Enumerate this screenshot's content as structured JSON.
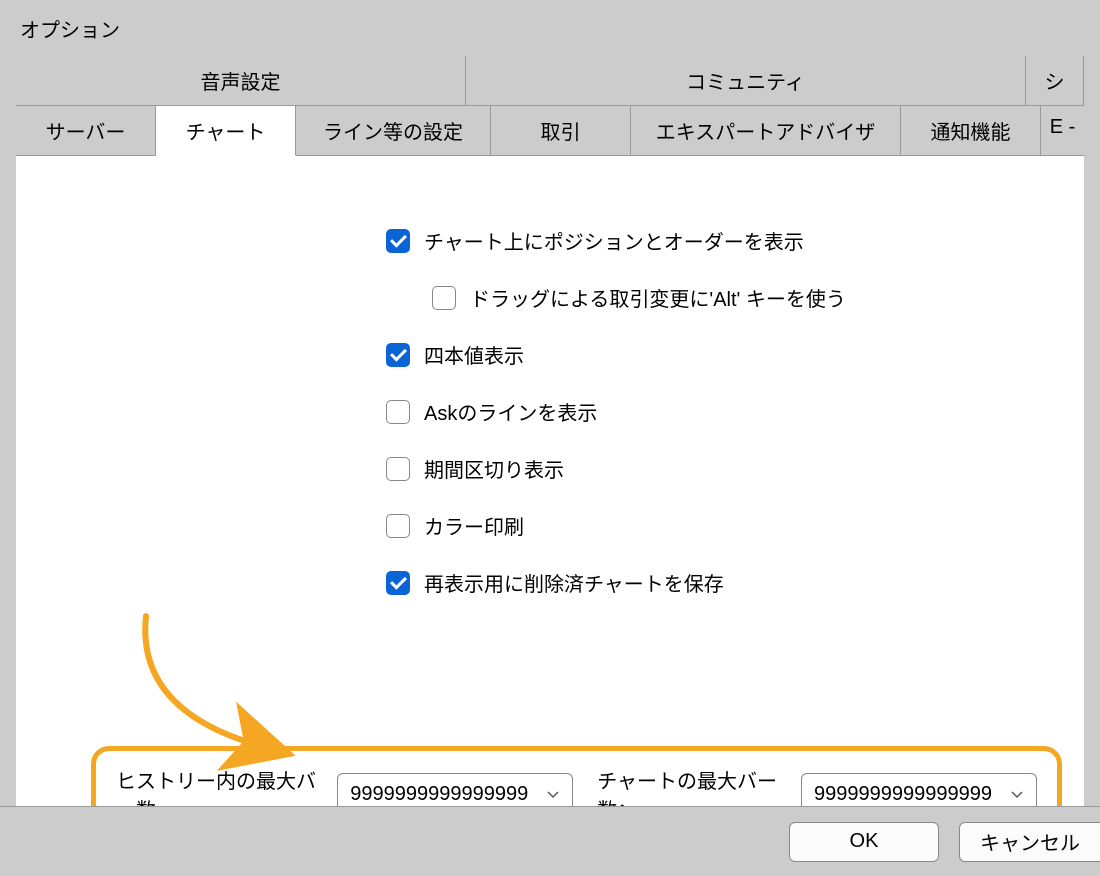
{
  "window": {
    "title": "オプション"
  },
  "tabs_top": {
    "audio": "音声設定",
    "community": "コミュニティ",
    "sig": "シ"
  },
  "tabs_sec": {
    "server": "サーバー",
    "chart": "チャート",
    "lines": "ライン等の設定",
    "trade": "取引",
    "ea": "エキスパートアドバイザ",
    "notify": "通知機能",
    "email": "E -"
  },
  "options": {
    "show_positions": "チャート上にポジションとオーダーを表示",
    "use_alt_drag": "ドラッグによる取引変更に'Alt' キーを使う",
    "ohlc": "四本値表示",
    "ask_line": "Askのラインを表示",
    "period_sep": "期間区切り表示",
    "color_print": "カラー印刷",
    "save_deleted": "再表示用に削除済チャートを保存"
  },
  "bars": {
    "history_label": "ヒストリー内の最大バー数",
    "history_value": "9999999999999999",
    "chart_label": "チャートの最大バー数：",
    "chart_value": "9999999999999999"
  },
  "buttons": {
    "ok": "OK",
    "cancel": "キャンセル"
  }
}
